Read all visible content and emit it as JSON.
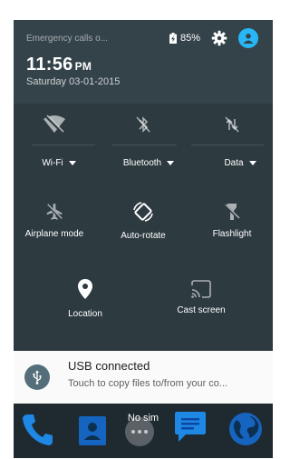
{
  "status": {
    "carrier_text": "Emergency calls o...",
    "battery_text": "85%",
    "time": "11:56",
    "ampm": "PM",
    "date": "Saturday 03-01-2015"
  },
  "quick_settings": {
    "wifi_label": "Wi-Fi",
    "bluetooth_label": "Bluetooth",
    "data_label": "Data",
    "airplane_label": "Airplane mode",
    "autorotate_label": "Auto-rotate",
    "flashlight_label": "Flashlight",
    "location_label": "Location",
    "cast_label": "Cast screen"
  },
  "notification": {
    "title": "USB connected",
    "text": "Touch to copy files to/from your co..."
  },
  "dock": {
    "status_text": "No sim"
  },
  "colors": {
    "panel": "#2d3a40",
    "header": "#34434a",
    "accent": "#29b6f6",
    "usb_icon_bg": "#546e7a"
  },
  "icons": [
    "battery-icon",
    "gear-icon",
    "account-icon",
    "wifi-off-icon",
    "bluetooth-off-icon",
    "data-off-icon",
    "airplane-icon",
    "autorotate-icon",
    "flashlight-icon",
    "location-icon",
    "cast-icon",
    "usb-icon",
    "phone-icon",
    "contacts-icon",
    "apps-icon",
    "messages-icon",
    "browser-icon"
  ]
}
